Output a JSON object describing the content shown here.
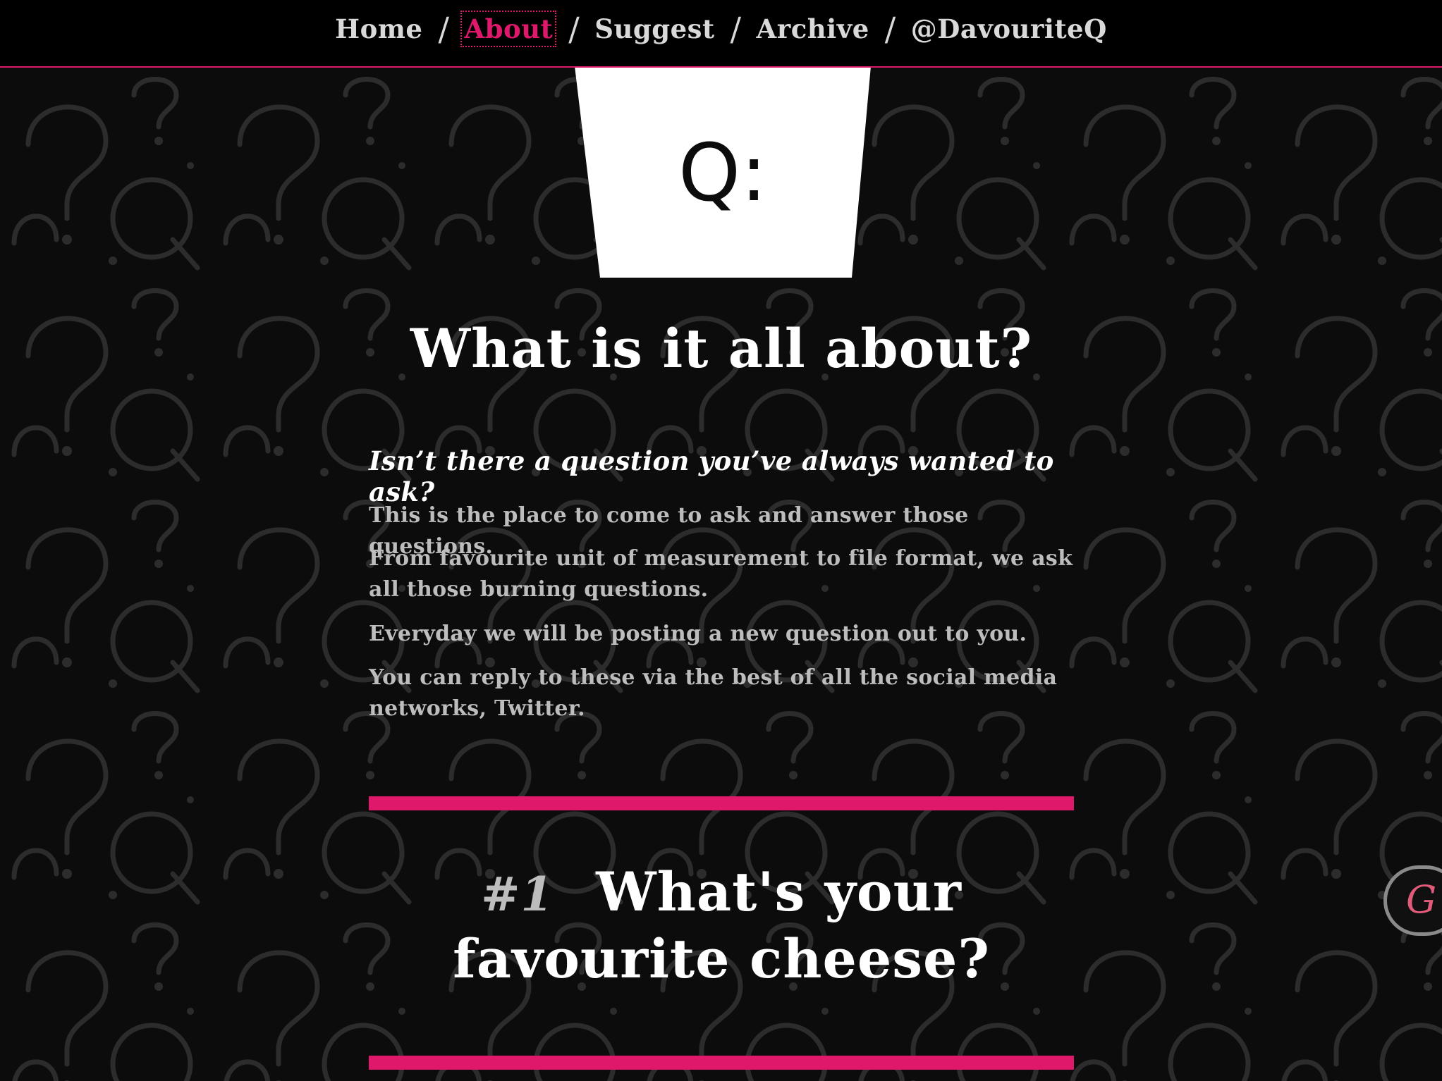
{
  "nav": {
    "items": [
      {
        "label": "Home",
        "active": false
      },
      {
        "label": "About",
        "active": true
      },
      {
        "label": "Suggest",
        "active": false
      },
      {
        "label": "Archive",
        "active": false
      },
      {
        "label": "@DavouriteQ",
        "active": false
      }
    ],
    "separator": "/"
  },
  "logo": {
    "text": "Q:"
  },
  "about": {
    "title": "What is it all about?",
    "lead": "Isn’t there a question you’ve always wanted to ask?",
    "paragraphs": [
      "This is the place to come to ask and answer those questions.",
      "From favourite unit of measurement to file format, we ask all those burning questions.",
      "Everyday we will be posting a new question out to you.",
      "You can reply to these via the best of all the social media networks, Twitter."
    ]
  },
  "question": {
    "number": "#1",
    "text": "What's your favourite cheese?"
  },
  "floating_button": {
    "glyph": "G"
  },
  "colors": {
    "accent": "#e0186c",
    "background": "#0c0c0c",
    "text_primary": "#ffffff",
    "text_secondary": "#bdbdbd"
  }
}
